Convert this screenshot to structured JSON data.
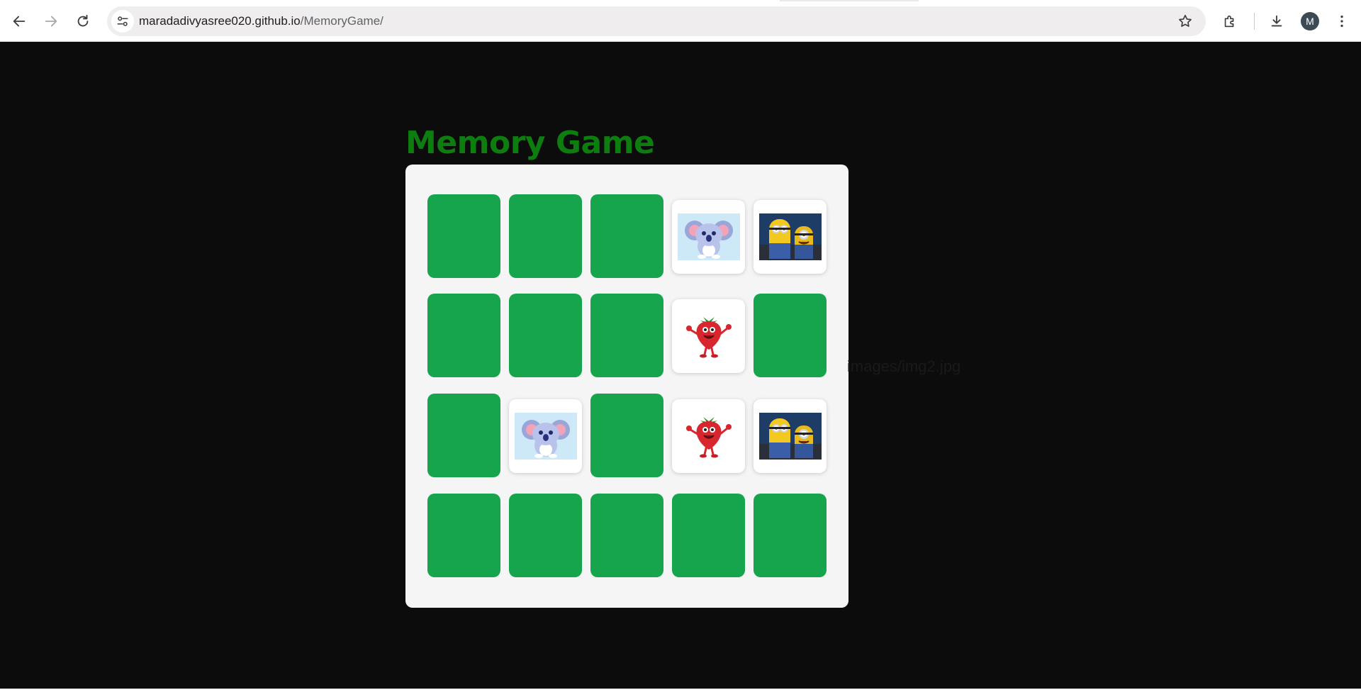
{
  "browser": {
    "url_host": "maradadivyasree020.github.io",
    "url_path": "/MemoryGame/",
    "profile_initial": "M"
  },
  "page": {
    "title": "Memory Game",
    "stray_text": "images/img2.jpg"
  },
  "colors": {
    "card_back": "#16a54d",
    "title": "#0e7d10",
    "background": "#0c0c0c",
    "board": "#f5f5f5"
  },
  "board": {
    "rows": 4,
    "cols": 5,
    "cards": [
      {
        "state": "hidden"
      },
      {
        "state": "hidden"
      },
      {
        "state": "hidden"
      },
      {
        "state": "revealed",
        "image": "koala"
      },
      {
        "state": "revealed",
        "image": "minions"
      },
      {
        "state": "hidden"
      },
      {
        "state": "hidden"
      },
      {
        "state": "hidden"
      },
      {
        "state": "revealed",
        "image": "strawberry"
      },
      {
        "state": "hidden"
      },
      {
        "state": "hidden"
      },
      {
        "state": "revealed",
        "image": "koala"
      },
      {
        "state": "hidden"
      },
      {
        "state": "revealed",
        "image": "strawberry"
      },
      {
        "state": "revealed",
        "image": "minions"
      },
      {
        "state": "hidden"
      },
      {
        "state": "hidden"
      },
      {
        "state": "hidden"
      },
      {
        "state": "hidden"
      },
      {
        "state": "hidden"
      }
    ]
  }
}
